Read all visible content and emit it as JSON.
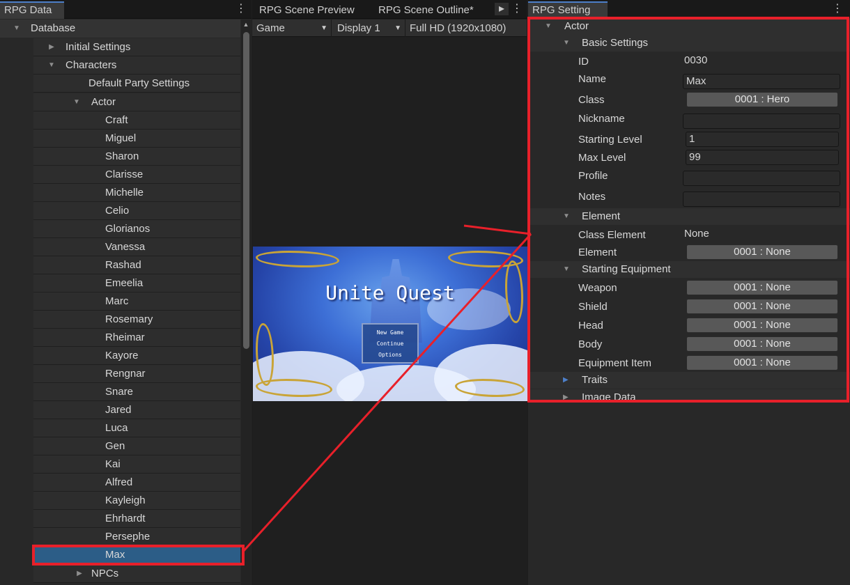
{
  "left_panel": {
    "tab": "RPG Data",
    "tree": {
      "database": "Database",
      "initial_settings": "Initial Settings",
      "characters": "Characters",
      "default_party": "Default Party Settings",
      "actor": "Actor",
      "actors": [
        "Craft",
        "Miguel",
        "Sharon",
        "Clarisse",
        "Michelle",
        "Celio",
        "Glorianos",
        "Vanessa",
        "Rashad",
        "Emeelia",
        "Marc",
        "Rosemary",
        "Rheimar",
        "Kayore",
        "Rengnar",
        "Snare",
        "Jared",
        "Luca",
        "Gen",
        "Kai",
        "Alfred",
        "Kayleigh",
        "Ehrhardt",
        "Persephe",
        "Max"
      ],
      "npcs": "NPCs"
    }
  },
  "middle_panel": {
    "tabs": [
      "RPG Scene Preview",
      "RPG Scene Outline*"
    ],
    "toolbar": {
      "mode": "Game",
      "display": "Display 1",
      "resolution": "Full HD (1920x1080)"
    },
    "game": {
      "title": "Unite Quest",
      "menu": [
        "New Game",
        "Continue",
        "Options"
      ]
    }
  },
  "right_panel": {
    "tab": "RPG Setting",
    "actor": "Actor",
    "basic_settings": {
      "header": "Basic Settings",
      "id_label": "ID",
      "id_value": "0030",
      "name_label": "Name",
      "name_value": "Max",
      "class_label": "Class",
      "class_value": "0001 : Hero",
      "nickname_label": "Nickname",
      "nickname_value": "",
      "starting_level_label": "Starting Level",
      "starting_level_value": "1",
      "max_level_label": "Max Level",
      "max_level_value": "99",
      "profile_label": "Profile",
      "profile_value": "",
      "notes_label": "Notes",
      "notes_value": ""
    },
    "element": {
      "header": "Element",
      "class_element_label": "Class Element",
      "class_element_value": "None",
      "element_label": "Element",
      "element_value": "0001 : None"
    },
    "starting_equipment": {
      "header": "Starting Equipment",
      "weapon_label": "Weapon",
      "weapon_value": "0001 : None",
      "shield_label": "Shield",
      "shield_value": "0001 : None",
      "head_label": "Head",
      "head_value": "0001 : None",
      "body_label": "Body",
      "body_value": "0001 : None",
      "item_label": "Equipment Item",
      "item_value": "0001 : None"
    },
    "traits": "Traits",
    "image_data": "Image Data"
  },
  "colors": {
    "annotation": "#e8202a",
    "selection": "#2c5d87",
    "accent": "#4d7fc9"
  }
}
